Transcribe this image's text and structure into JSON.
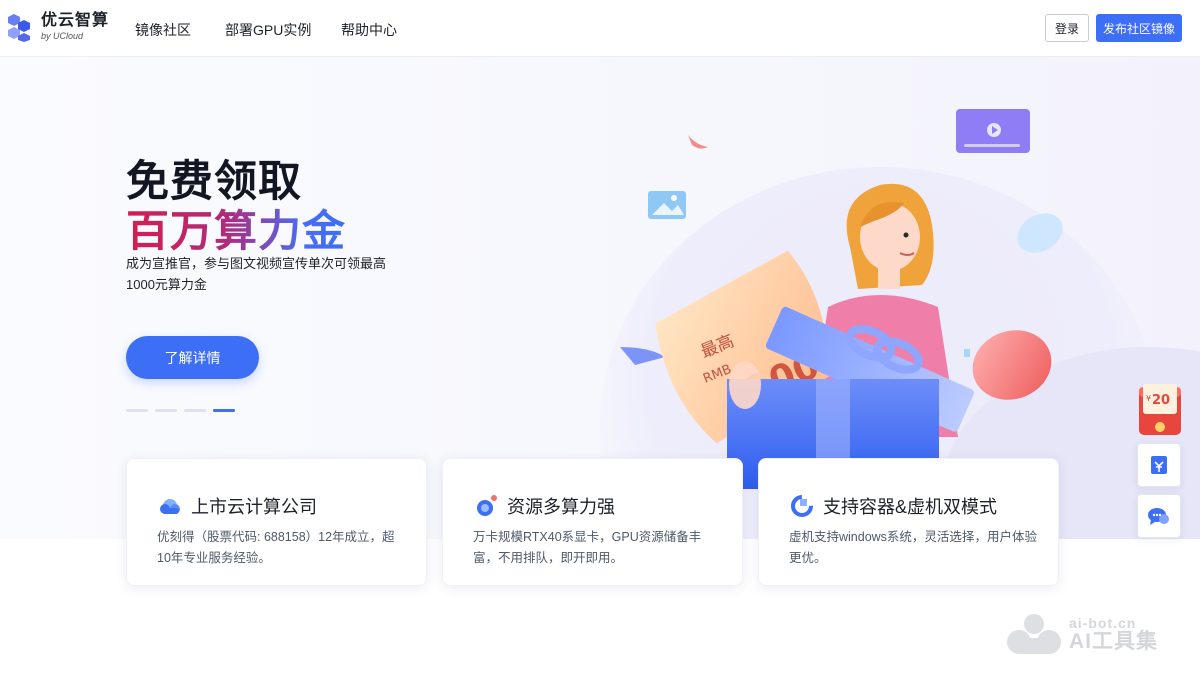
{
  "brand": {
    "name_cn": "优云智算",
    "name_en": "by UCloud",
    "logo_icon": "cube-cluster-icon",
    "accent": "#3c6ef6"
  },
  "nav": {
    "items": [
      {
        "label": "镜像社区"
      },
      {
        "label": "部署GPU实例"
      },
      {
        "label": "帮助中心"
      }
    ],
    "login_label": "登录",
    "publish_label": "发布社区镜像"
  },
  "hero": {
    "title_line1": "免费领取",
    "title_line2": "百万算力金",
    "description": "成为宣推官，参与图文视频宣传单次可领最高1000元算力金",
    "cta_label": "了解详情",
    "slides_total": 4,
    "slide_active": 4,
    "coupon": {
      "label_top": "最高",
      "currency": "RMB",
      "amount": "1000"
    }
  },
  "features": [
    {
      "icon": "cloud-icon",
      "title": "上市云计算公司",
      "desc": "优刻得（股票代码: 688158）12年成立，超10年专业服务经验。"
    },
    {
      "icon": "gpu-orbit-icon",
      "title": "资源多算力强",
      "desc": "万卡规模RTX40系显卡，GPU资源储备丰富，不用排队，即开即用。"
    },
    {
      "icon": "container-ring-icon",
      "title": "支持容器&虚机双模式",
      "desc": "虚机支持windows系统，灵活选择，用户体验更优。"
    }
  ],
  "float_bar": {
    "red_packet_amount": "20",
    "red_packet_symbol": "¥",
    "buttons": [
      "coupon-icon",
      "chat-icon"
    ]
  },
  "watermark": {
    "line1": "ai-bot.cn",
    "line2": "AI工具集"
  }
}
